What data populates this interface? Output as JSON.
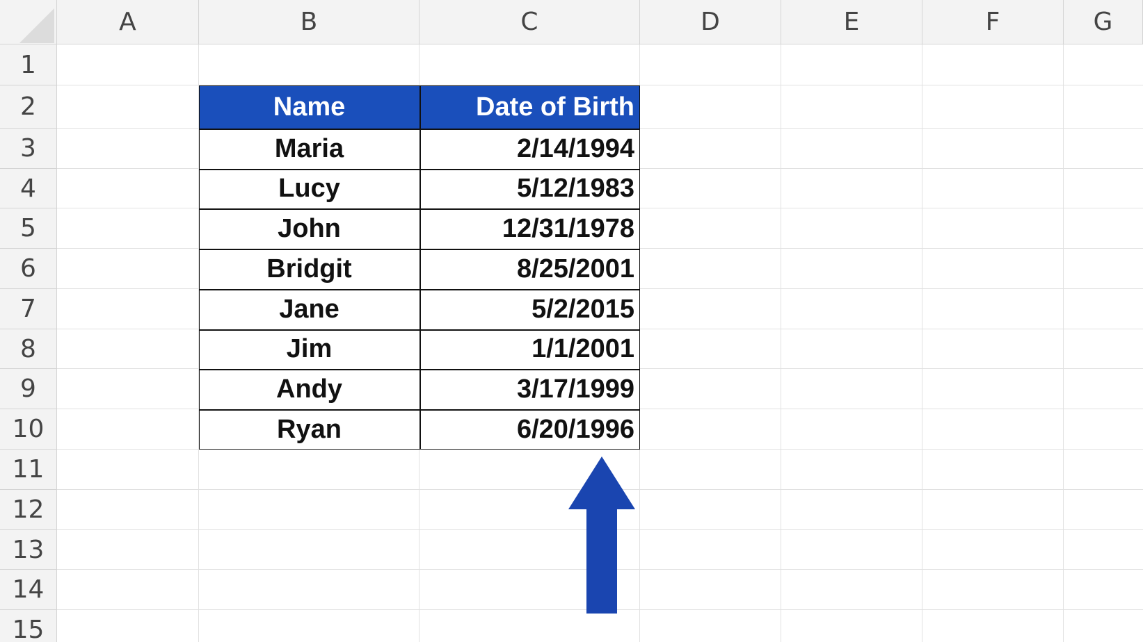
{
  "columns": [
    "A",
    "B",
    "C",
    "D",
    "E",
    "F",
    "G"
  ],
  "rows": [
    "1",
    "2",
    "3",
    "4",
    "5",
    "6",
    "7",
    "8",
    "9",
    "10",
    "11",
    "12",
    "13",
    "14",
    "15"
  ],
  "table": {
    "headers": {
      "name": "Name",
      "dob": "Date of Birth"
    },
    "records": [
      {
        "name": "Maria",
        "dob": "2/14/1994"
      },
      {
        "name": "Lucy",
        "dob": "5/12/1983"
      },
      {
        "name": "John",
        "dob": "12/31/1978"
      },
      {
        "name": "Bridgit",
        "dob": "8/25/2001"
      },
      {
        "name": "Jane",
        "dob": "5/2/2015"
      },
      {
        "name": "Jim",
        "dob": "1/1/2001"
      },
      {
        "name": "Andy",
        "dob": "3/17/1999"
      },
      {
        "name": "Ryan",
        "dob": "6/20/1996"
      }
    ]
  },
  "colors": {
    "header_fill": "#1a4fbb",
    "arrow": "#1a45b0"
  },
  "annotation": {
    "icon": "arrow-up-icon"
  }
}
